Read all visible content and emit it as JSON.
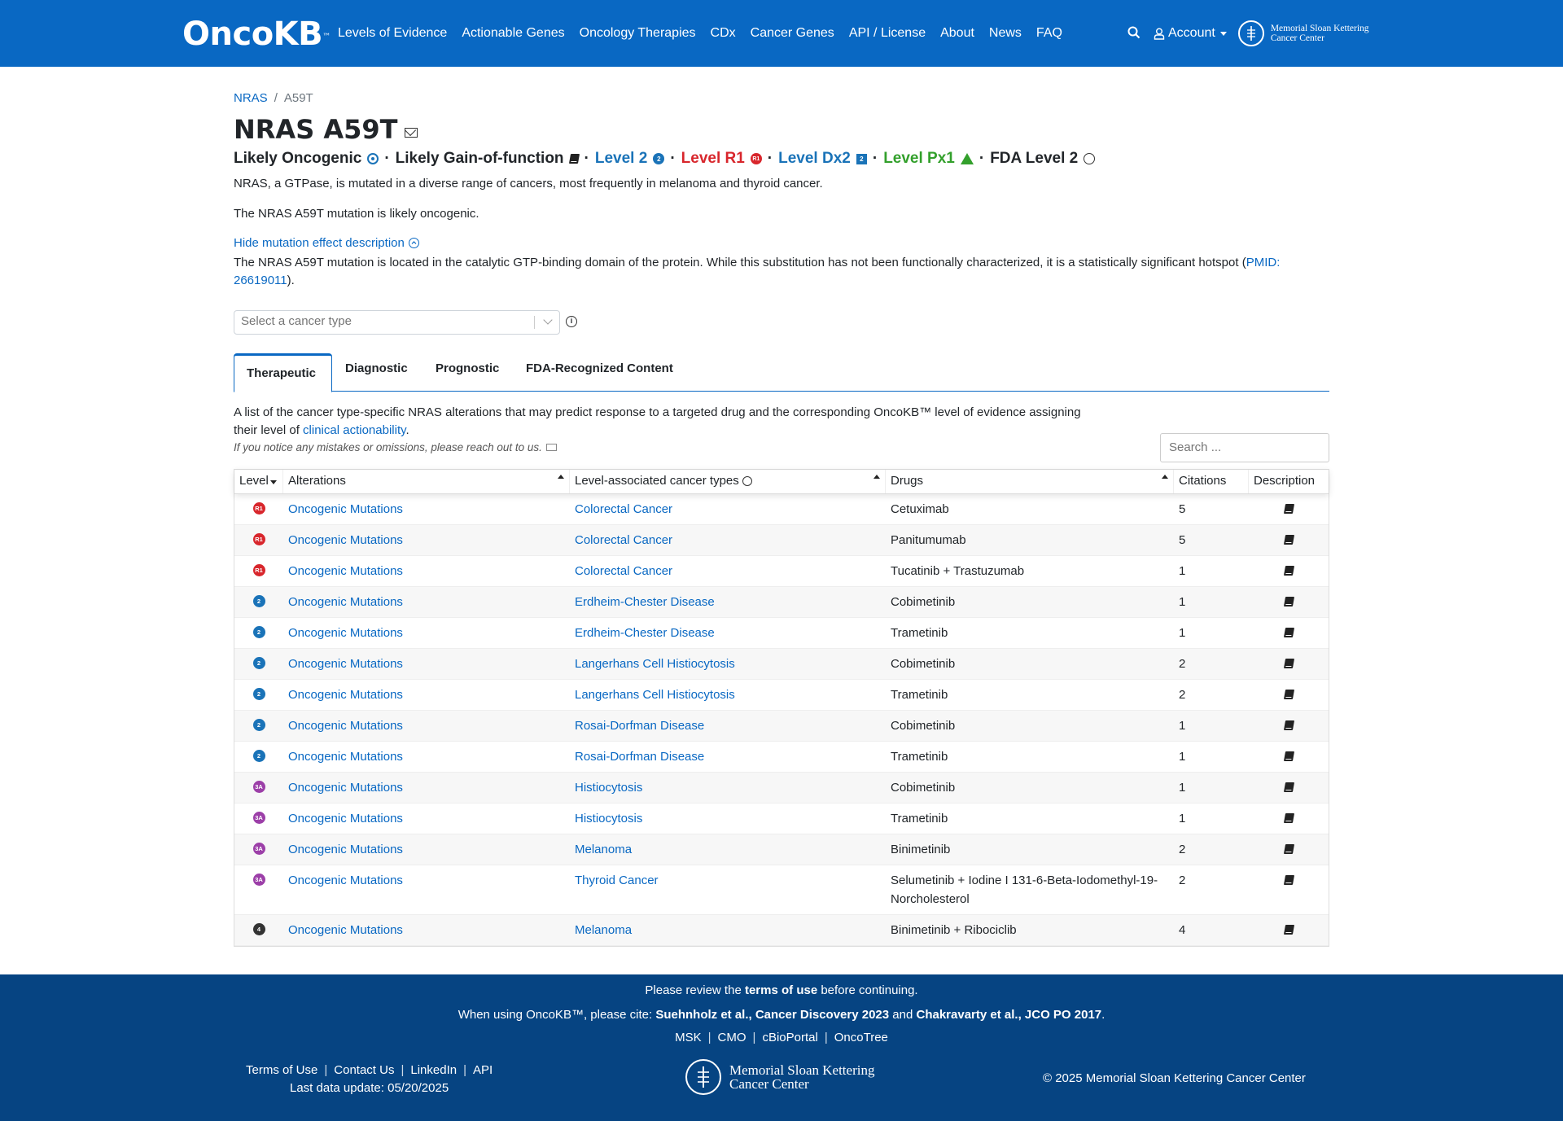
{
  "nav": {
    "logo": "OncoKB",
    "logo_tm": "™",
    "links": [
      "Levels of Evidence",
      "Actionable Genes",
      "Oncology Therapies",
      "CDx",
      "Cancer Genes",
      "API / License",
      "About",
      "News",
      "FAQ"
    ],
    "account": "Account",
    "msk_line1": "Memorial Sloan Kettering",
    "msk_line2": "Cancer Center"
  },
  "breadcrumb": {
    "gene": "NRAS",
    "separator": "/",
    "alteration": "A59T"
  },
  "title": "NRAS A59T",
  "summary": {
    "oncogenic": "Likely Oncogenic",
    "effect": "Likely Gain-of-function",
    "level": "Level 2",
    "level_r": "Level R1",
    "level_dx": "Level Dx2",
    "level_px": "Level Px1",
    "fda": "FDA Level 2",
    "sep": "·",
    "level_badge": "2",
    "level_r_badge": "R1",
    "level_dx_badge": "2",
    "level_px_badge": "1"
  },
  "gene_summary": "NRAS, a GTPase, is mutated in a diverse range of cancers, most frequently in melanoma and thyroid cancer.",
  "variant_summary": "The NRAS A59T mutation is likely oncogenic.",
  "toggle_label": "Hide mutation effect description",
  "mutation_effect": {
    "text": "The NRAS A59T mutation is located in the catalytic GTP-binding domain of the protein. While this substitution has not been functionally characterized, it is a statistically significant hotspot (",
    "pmid": "PMID: 26619011",
    "end": ")."
  },
  "cancer_select_placeholder": "Select a cancer type",
  "tabs": [
    "Therapeutic",
    "Diagnostic",
    "Prognostic",
    "FDA-Recognized Content"
  ],
  "tab_description": {
    "text": "A list of the cancer type-specific NRAS alterations that may predict response to a targeted drug and the corresponding OncoKB™ level of evidence assigning their level of ",
    "link": "clinical actionability",
    "end": "."
  },
  "feedback_note": "If you notice any mistakes or omissions, please reach out to us.",
  "search_placeholder": "Search ...",
  "table": {
    "headers": [
      "Level",
      "Alterations",
      "Level-associated cancer types",
      "Drugs",
      "Citations",
      "Description"
    ],
    "rows": [
      {
        "level": "R1",
        "color": "#d8262c",
        "alteration": "Oncogenic Mutations",
        "cancer": "Colorectal Cancer",
        "drugs": "Cetuximab",
        "citations": "5"
      },
      {
        "level": "R1",
        "color": "#d8262c",
        "alteration": "Oncogenic Mutations",
        "cancer": "Colorectal Cancer",
        "drugs": "Panitumumab",
        "citations": "5"
      },
      {
        "level": "R1",
        "color": "#d8262c",
        "alteration": "Oncogenic Mutations",
        "cancer": "Colorectal Cancer",
        "drugs": "Tucatinib + Trastuzumab",
        "citations": "1"
      },
      {
        "level": "2",
        "color": "#1a73b8",
        "alteration": "Oncogenic Mutations",
        "cancer": "Erdheim-Chester Disease",
        "drugs": "Cobimetinib",
        "citations": "1"
      },
      {
        "level": "2",
        "color": "#1a73b8",
        "alteration": "Oncogenic Mutations",
        "cancer": "Erdheim-Chester Disease",
        "drugs": "Trametinib",
        "citations": "1"
      },
      {
        "level": "2",
        "color": "#1a73b8",
        "alteration": "Oncogenic Mutations",
        "cancer": "Langerhans Cell Histiocytosis",
        "drugs": "Cobimetinib",
        "citations": "2"
      },
      {
        "level": "2",
        "color": "#1a73b8",
        "alteration": "Oncogenic Mutations",
        "cancer": "Langerhans Cell Histiocytosis",
        "drugs": "Trametinib",
        "citations": "2"
      },
      {
        "level": "2",
        "color": "#1a73b8",
        "alteration": "Oncogenic Mutations",
        "cancer": "Rosai-Dorfman Disease",
        "drugs": "Cobimetinib",
        "citations": "1"
      },
      {
        "level": "2",
        "color": "#1a73b8",
        "alteration": "Oncogenic Mutations",
        "cancer": "Rosai-Dorfman Disease",
        "drugs": "Trametinib",
        "citations": "1"
      },
      {
        "level": "3A",
        "color": "#9c3fa8",
        "alteration": "Oncogenic Mutations",
        "cancer": "Histiocytosis",
        "drugs": "Cobimetinib",
        "citations": "1"
      },
      {
        "level": "3A",
        "color": "#9c3fa8",
        "alteration": "Oncogenic Mutations",
        "cancer": "Histiocytosis",
        "drugs": "Trametinib",
        "citations": "1"
      },
      {
        "level": "3A",
        "color": "#9c3fa8",
        "alteration": "Oncogenic Mutations",
        "cancer": "Melanoma",
        "drugs": "Binimetinib",
        "citations": "2"
      },
      {
        "level": "3A",
        "color": "#9c3fa8",
        "alteration": "Oncogenic Mutations",
        "cancer": "Thyroid Cancer",
        "drugs": "Selumetinib + Iodine I 131-6-Beta-Iodomethyl-19-Norcholesterol",
        "citations": "2"
      },
      {
        "level": "4",
        "color": "#333333",
        "alteration": "Oncogenic Mutations",
        "cancer": "Melanoma",
        "drugs": "Binimetinib + Ribociclib",
        "citations": "4"
      }
    ]
  },
  "footer": {
    "review_pre": "Please review the ",
    "review_link": "terms of use",
    "review_post": " before continuing.",
    "cite_pre": "When using OncoKB™, please cite: ",
    "cite_1": "Suehnholz et al., Cancer Discovery 2023",
    "cite_and": " and ",
    "cite_2": "Chakravarty et al., JCO PO 2017",
    "cite_end": ".",
    "links": [
      "MSK",
      "CMO",
      "cBioPortal",
      "OncoTree"
    ],
    "left_links": [
      "Terms of Use",
      "Contact Us",
      "LinkedIn",
      "API"
    ],
    "last_update": "Last data update: 05/20/2025",
    "msk_line1": "Memorial Sloan Kettering",
    "msk_line2": "Cancer Center",
    "copyright": "© 2025 Memorial Sloan Kettering Cancer Center"
  },
  "colors": {
    "primary": "#0968c3",
    "footer": "#064482",
    "level2": "#1a73b8",
    "levelR1": "#d8262c",
    "levelPx": "#33a02c",
    "level3A": "#9c3fa8"
  }
}
